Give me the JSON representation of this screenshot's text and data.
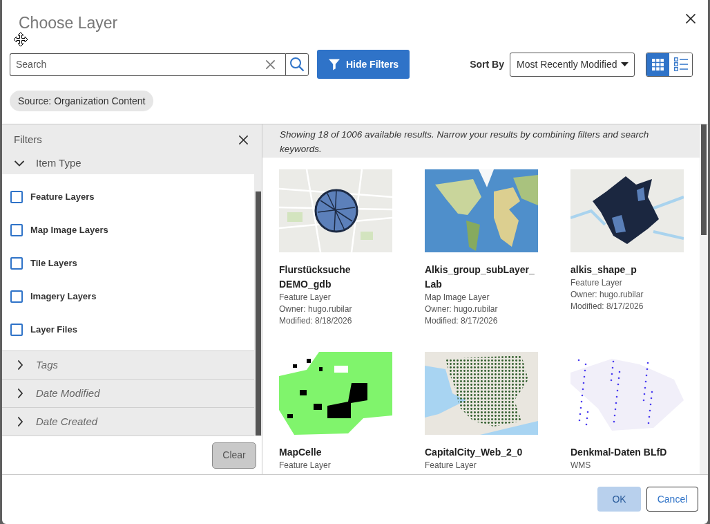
{
  "dialog": {
    "title": "Choose Layer"
  },
  "toolbar": {
    "search": {
      "placeholder": "Search"
    },
    "filter_button": "Hide Filters",
    "sort": {
      "label": "Sort By",
      "value": "Most Recently Modified"
    },
    "views": [
      {
        "kind": "grid",
        "selected": true
      },
      {
        "kind": "list",
        "selected": false
      }
    ]
  },
  "chips": [
    "Source: Organization Content"
  ],
  "filters": {
    "title": "Filters",
    "sections": [
      {
        "label": "Item Type",
        "expanded": true,
        "options": [
          {
            "label": "Feature Layers",
            "checked": false
          },
          {
            "label": "Map Image Layers",
            "checked": false
          },
          {
            "label": "Tile Layers",
            "checked": false
          },
          {
            "label": "Imagery Layers",
            "checked": false
          },
          {
            "label": "Layer Files",
            "checked": false
          }
        ]
      },
      {
        "label": "Tags",
        "expanded": false
      },
      {
        "label": "Date Modified",
        "expanded": false
      },
      {
        "label": "Date Created",
        "expanded": false
      }
    ],
    "clear_button": {
      "label": "Clear",
      "disabled": true
    }
  },
  "results": {
    "summary": "Showing 18 of 1006 available results. Narrow your results by combining filters and search keywords.",
    "items": [
      {
        "title": "Flurstücksuche DEMO_gdb",
        "type": "Feature Layer",
        "owner": "Owner: hugo.rubilar",
        "modified": "Modified: 8/18/2026",
        "kind": "circle"
      },
      {
        "title": "Alkis_group_subLayer_Lab",
        "type": "Map Image Layer",
        "owner": "Owner: hugo.rubilar",
        "modified": "Modified: 8/17/2026",
        "kind": "world"
      },
      {
        "title": "alkis_shape_p",
        "type": "Feature Layer",
        "owner": "Owner: hugo.rubilar",
        "modified": "Modified: 8/17/2026",
        "kind": "blob"
      },
      {
        "title": "MapCelle",
        "type": "Feature Layer",
        "kind": "green"
      },
      {
        "title": "CapitalCity_Web_2_0",
        "type": "Feature Layer",
        "kind": "streets"
      },
      {
        "title": "Denkmal-Daten BLfD",
        "type": "WMS",
        "kind": "dots"
      }
    ]
  },
  "footer": {
    "buttons": [
      {
        "label": "OK",
        "kind": "primary",
        "disabled": true
      },
      {
        "label": "Cancel",
        "kind": "secondary",
        "disabled": false
      }
    ]
  }
}
